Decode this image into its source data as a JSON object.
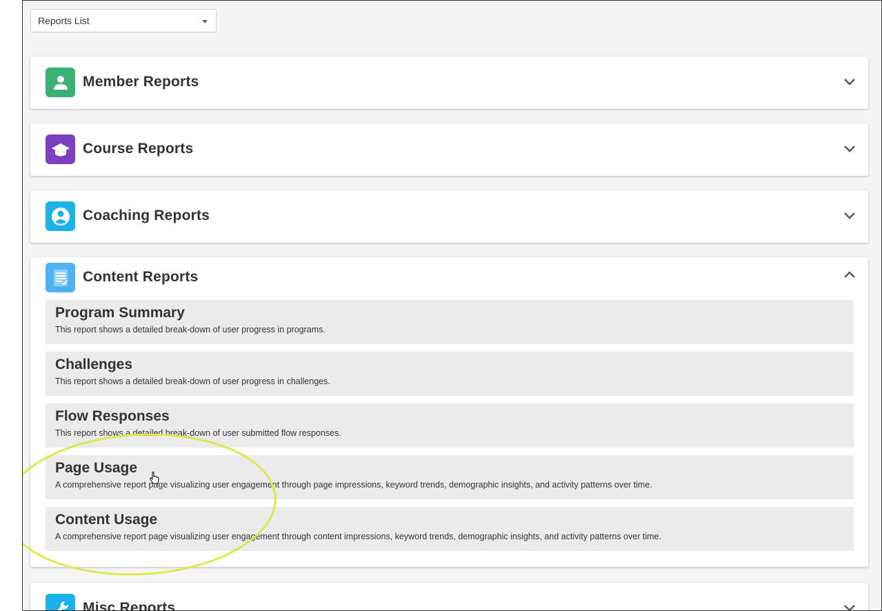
{
  "selector": {
    "value": "Reports List"
  },
  "sections": [
    {
      "title": "Member Reports",
      "icon": "person-icon",
      "color": "#3bb273",
      "expanded": false
    },
    {
      "title": "Course Reports",
      "icon": "graduation-cap-icon",
      "color": "#7b3fbf",
      "expanded": false
    },
    {
      "title": "Coaching Reports",
      "icon": "coach-avatar-icon",
      "color": "#1ab2e8",
      "expanded": false
    },
    {
      "title": "Content Reports",
      "icon": "checklist-icon",
      "color": "#4fb3f0",
      "expanded": true,
      "items": [
        {
          "title": "Program Summary",
          "desc": "This report shows a detailed break-down of user progress in programs."
        },
        {
          "title": "Challenges",
          "desc": "This report shows a detailed break-down of user progress in challenges."
        },
        {
          "title": "Flow Responses",
          "desc": "This report shows a detailed break-down of user submitted flow responses."
        },
        {
          "title": "Page Usage",
          "desc": "A comprehensive report page visualizing user engagement through page impressions, keyword trends, demographic insights, and activity patterns over time."
        },
        {
          "title": "Content Usage",
          "desc": "A comprehensive report page visualizing user engagement through content impressions, keyword trends, demographic insights, and activity patterns over time."
        }
      ]
    },
    {
      "title": "Misc Reports",
      "icon": "wrench-icon",
      "color": "#1ab2e8",
      "expanded": false
    }
  ]
}
